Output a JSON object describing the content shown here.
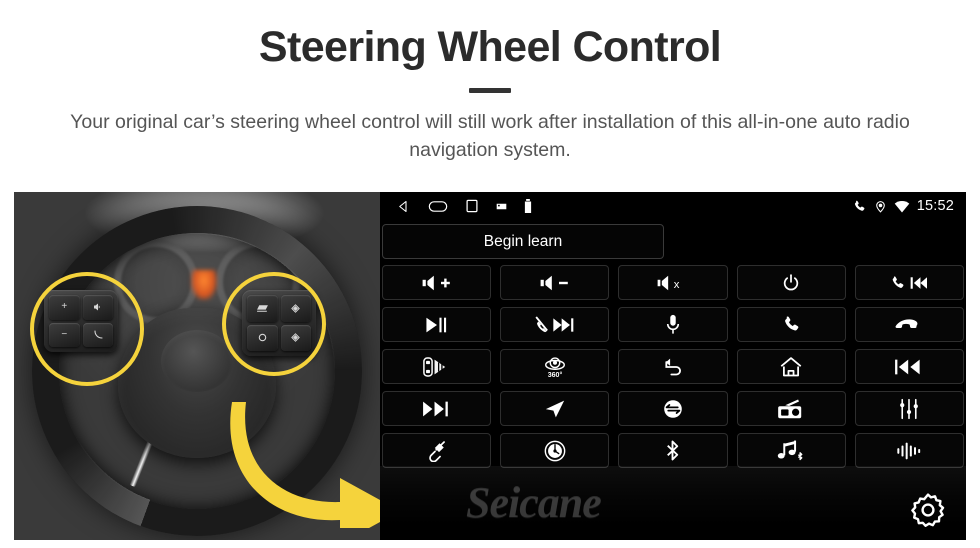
{
  "header": {
    "title": "Steering Wheel Control",
    "subtitle": "Your original car’s steering wheel control will still work after installation of this all-in-one auto radio navigation system."
  },
  "colors": {
    "highlight_yellow": "#F5D33C",
    "title_text": "#2b2b2b",
    "subtitle_text": "#555555",
    "screen_background": "#000000",
    "button_border": "#2e2e2e"
  },
  "photo": {
    "alt": "Car steering wheel with original control pads highlighted in yellow circles",
    "left_pad_keys": [
      "volume-up",
      "voice-command",
      "volume-down",
      "answer-call"
    ],
    "right_pad_keys": [
      "mode-source",
      "up-arrow",
      "circle-select",
      "down-arrow"
    ],
    "highlight_count": 2,
    "arrow": "points right toward the head unit screen"
  },
  "unit": {
    "statusbar": {
      "left_icons": [
        "back-icon",
        "home-icon",
        "recents-icon",
        "sd-card-icon",
        "usb-drive-icon"
      ],
      "right_icons": [
        "phone-signal-icon",
        "location-icon",
        "wifi-icon"
      ],
      "time": "15:52"
    },
    "learn_button": {
      "label": "Begin learn"
    },
    "grid": {
      "rows": 5,
      "columns": 5,
      "cells": [
        {
          "name": "volume-up-button",
          "icon": "speaker-plus-icon",
          "label": "Volume +"
        },
        {
          "name": "volume-down-button",
          "icon": "speaker-minus-icon",
          "label": "Volume −"
        },
        {
          "name": "mute-button",
          "icon": "speaker-mute-icon",
          "label": "Mute"
        },
        {
          "name": "power-button",
          "icon": "power-icon",
          "label": "Power"
        },
        {
          "name": "answer-previous-button",
          "icon": "phone-prev-icon",
          "label": "Answer / Previous"
        },
        {
          "name": "play-pause-button",
          "icon": "play-pause-icon",
          "label": "Play / Pause"
        },
        {
          "name": "hangup-next-button",
          "icon": "hangup-next-icon",
          "label": "Hang up / Next"
        },
        {
          "name": "voice-mic-button",
          "icon": "microphone-icon",
          "label": "Voice"
        },
        {
          "name": "call-button",
          "icon": "phone-icon",
          "label": "Call"
        },
        {
          "name": "hangup-button",
          "icon": "phone-hangup-icon",
          "label": "Hang up"
        },
        {
          "name": "parking-radar-button",
          "icon": "car-radar-icon",
          "label": "Parking radar"
        },
        {
          "name": "panorama-360-button",
          "icon": "camera-360-icon",
          "label": "360° camera"
        },
        {
          "name": "back-button",
          "icon": "back-arrow-icon",
          "label": "Back"
        },
        {
          "name": "home-button",
          "icon": "home-outline-icon",
          "label": "Home"
        },
        {
          "name": "previous-track-button",
          "icon": "previous-track-icon",
          "label": "Previous"
        },
        {
          "name": "next-track-button",
          "icon": "next-track-icon",
          "label": "Next"
        },
        {
          "name": "navigation-button",
          "icon": "navigation-arrow-icon",
          "label": "Navigation"
        },
        {
          "name": "source-switch-button",
          "icon": "source-swap-icon",
          "label": "Source"
        },
        {
          "name": "radio-button",
          "icon": "radio-icon",
          "label": "Radio"
        },
        {
          "name": "equalizer-button",
          "icon": "equalizer-icon",
          "label": "Equalizer"
        },
        {
          "name": "usb-button",
          "icon": "usb-plug-icon",
          "label": "USB"
        },
        {
          "name": "disc-button",
          "icon": "disc-icon",
          "label": "Disc"
        },
        {
          "name": "bluetooth-button",
          "icon": "bluetooth-icon",
          "label": "Bluetooth"
        },
        {
          "name": "bluetooth-music-button",
          "icon": "bluetooth-music-icon",
          "label": "Bluetooth music"
        },
        {
          "name": "voice-wave-button",
          "icon": "voice-wave-icon",
          "label": "Voice wave"
        }
      ]
    },
    "watermark": "Seicane",
    "settings_button": {
      "icon": "gear-icon",
      "label": "Settings"
    }
  }
}
